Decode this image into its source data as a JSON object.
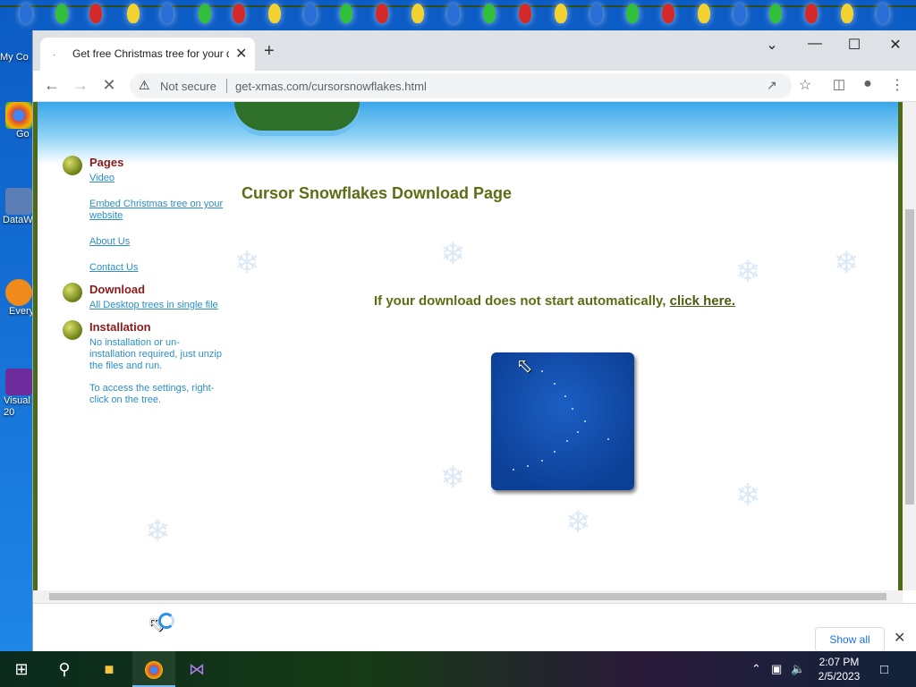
{
  "browser": {
    "tab_title": "Get free Christmas tree for your d",
    "new_tab_icon": "+",
    "url": "get-xmas.com/cursorsnowflakes.html",
    "security_label": "Not secure",
    "window_controls": {
      "minimize": "—",
      "maximize": "☐",
      "close": "✕",
      "tab_search": "⌄"
    }
  },
  "desktop": {
    "icons": [
      {
        "label": "My Co"
      },
      {
        "label": "Go Chr"
      },
      {
        "label": "DataW"
      },
      {
        "label": "Every"
      },
      {
        "label": "Visual 20"
      }
    ]
  },
  "nav": {
    "pages_title": "Pages",
    "pages_links": [
      "Video",
      "Embed Christmas tree on your website",
      "About Us",
      "Contact Us"
    ],
    "download_title": "Download",
    "download_links": [
      "All Desktop trees in single file"
    ],
    "installation_title": "Installation",
    "installation_text_1": "No installation or un-installation required, just unzip the files and run.",
    "installation_text_2": "To access the settings, right-click on the tree."
  },
  "main": {
    "title": "Cursor Snowflakes Download Page",
    "download_message": "If your download does not start automatically,",
    "download_link": "click here."
  },
  "download_bar": {
    "show_all": "Show all",
    "close_icon": "✕"
  },
  "taskbar": {
    "time": "2:07 PM",
    "date": "2/5/2023"
  },
  "colors": {
    "accent_green": "#5b6e14",
    "nav_title_red": "#8b1a1a",
    "link_blue": "#2a8fc7"
  }
}
